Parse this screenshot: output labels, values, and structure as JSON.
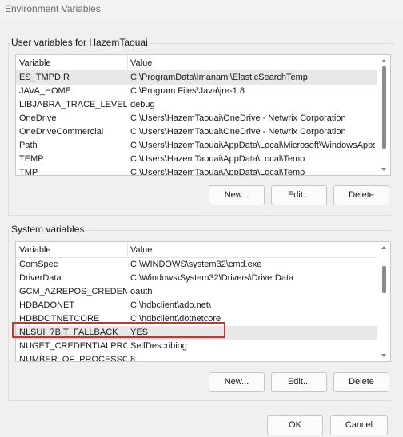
{
  "window": {
    "title": "Environment Variables"
  },
  "user_vars": {
    "group_label": "User variables for HazemTaouai",
    "columns": [
      "Variable",
      "Value"
    ],
    "rows": [
      {
        "variable": "ES_TMPDIR",
        "value": "C:\\ProgramData\\Imanami\\ElasticSearchTemp"
      },
      {
        "variable": "JAVA_HOME",
        "value": "C:\\Program Files\\Java\\jre-1.8"
      },
      {
        "variable": "LIBJABRA_TRACE_LEVEL",
        "value": "debug"
      },
      {
        "variable": "OneDrive",
        "value": "C:\\Users\\HazemTaouai\\OneDrive - Netwrix Corporation"
      },
      {
        "variable": "OneDriveCommercial",
        "value": "C:\\Users\\HazemTaouai\\OneDrive - Netwrix Corporation"
      },
      {
        "variable": "Path",
        "value": "C:\\Users\\HazemTaouai\\AppData\\Local\\Microsoft\\WindowsApps;..."
      },
      {
        "variable": "TEMP",
        "value": "C:\\Users\\HazemTaouai\\AppData\\Local\\Temp"
      },
      {
        "variable": "TMP",
        "value": "C:\\Users\\HazemTaouai\\AppData\\Local\\Temp"
      }
    ],
    "selected_index": 0,
    "buttons": {
      "new": "New...",
      "edit": "Edit...",
      "delete": "Delete"
    }
  },
  "system_vars": {
    "group_label": "System variables",
    "columns": [
      "Variable",
      "Value"
    ],
    "rows": [
      {
        "variable": "ComSpec",
        "value": "C:\\WINDOWS\\system32\\cmd.exe"
      },
      {
        "variable": "DriverData",
        "value": "C:\\Windows\\System32\\Drivers\\DriverData"
      },
      {
        "variable": "GCM_AZREPOS_CREDENTI...",
        "value": "oauth"
      },
      {
        "variable": "HDBADONET",
        "value": "C:\\hdbclient\\ado.net\\"
      },
      {
        "variable": "HDBDOTNETCORE",
        "value": "C:\\hdbclient\\dotnetcore"
      },
      {
        "variable": "NLSUI_7BIT_FALLBACK",
        "value": "YES"
      },
      {
        "variable": "NUGET_CREDENTIALPROVI...",
        "value": "SelfDescribing"
      },
      {
        "variable": "NUMBER_OF_PROCESSORS",
        "value": "8"
      }
    ],
    "selected_index": 5,
    "highlight_color": "#d32f2f",
    "buttons": {
      "new": "New...",
      "edit": "Edit...",
      "delete": "Delete"
    }
  },
  "footer": {
    "ok": "OK",
    "cancel": "Cancel"
  }
}
